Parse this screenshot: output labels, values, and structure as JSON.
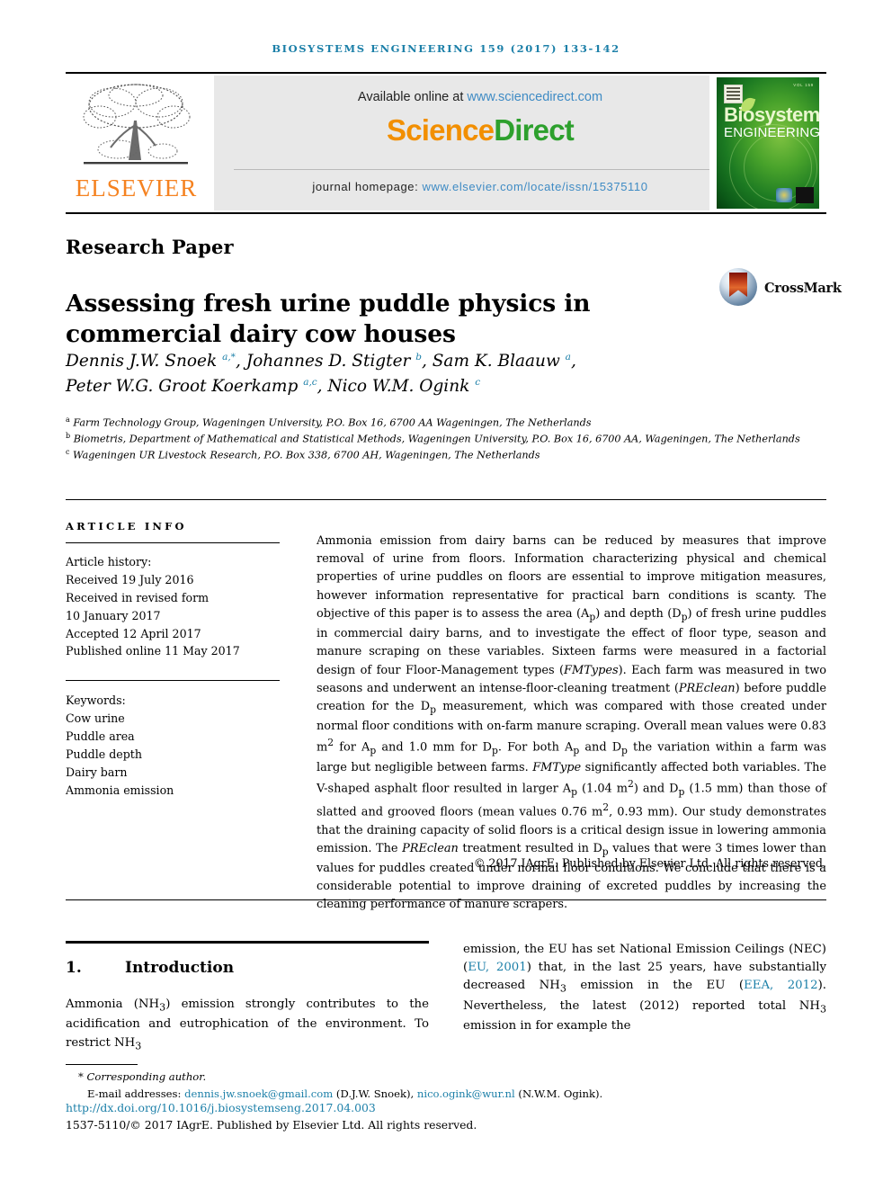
{
  "running_head": "BIOSYSTEMS ENGINEERING 159 (2017) 133-142",
  "masthead": {
    "available_label": "Available online at ",
    "available_url": "www.sciencedirect.com",
    "logo_first": "Science",
    "logo_second": "Direct",
    "homepage_label": "journal homepage: ",
    "homepage_url": "www.elsevier.com/locate/issn/15375110",
    "publisher_name": "ELSEVIER",
    "cover": {
      "title_line1": "Biosystems",
      "title_line2": "ENGINEERING",
      "volume_label": "VOL 159"
    }
  },
  "article": {
    "type": "Research Paper",
    "title": "Assessing fresh urine puddle physics in commercial dairy cow houses",
    "crossmark_label": "CrossMark",
    "authors_line1_a": "Dennis J.W. Snoek ",
    "authors_sup1": "a,*",
    "authors_line1_b": ", Johannes D. Stigter ",
    "authors_sup2": "b",
    "authors_line1_c": ", Sam K. Blaauw ",
    "authors_sup3": "a",
    "authors_line1_d": ",",
    "authors_line2_a": "Peter W.G. Groot Koerkamp ",
    "authors_sup4": "a,c",
    "authors_line2_b": ", Nico W.M. Ogink ",
    "authors_sup5": "c",
    "affiliations": [
      {
        "mark": "a",
        "text": "Farm Technology Group, Wageningen University, P.O. Box 16, 6700 AA Wageningen, The Netherlands"
      },
      {
        "mark": "b",
        "text": "Biometris, Department of Mathematical and Statistical Methods, Wageningen University, P.O. Box 16, 6700 AA, Wageningen, The Netherlands"
      },
      {
        "mark": "c",
        "text": "Wageningen UR Livestock Research, P.O. Box 338, 6700 AH, Wageningen, The Netherlands"
      }
    ]
  },
  "article_info": {
    "heading": "ARTICLE INFO",
    "history_label": "Article history:",
    "received": "Received 19 July 2016",
    "revised_label": "Received in revised form",
    "revised_date": "10 January 2017",
    "accepted": "Accepted 12 April 2017",
    "published": "Published online 11 May 2017",
    "keywords_label": "Keywords:",
    "keywords": [
      "Cow urine",
      "Puddle area",
      "Puddle depth",
      "Dairy barn",
      "Ammonia emission"
    ]
  },
  "abstract": {
    "p1": "Ammonia emission from dairy barns can be reduced by measures that improve removal of urine from floors. Information characterizing physical and chemical properties of urine puddles on floors are essential to improve mitigation measures, however information representative for practical barn conditions is scanty. The objective of this paper is to assess the area (A",
    "sub_p": "p",
    "p2": ") and depth (D",
    "p3": ") of fresh urine puddles in commercial dairy barns, and to investigate the effect of floor type, season and manure scraping on these variables. Sixteen farms were measured in a factorial design of four Floor-Management types (",
    "it_fmtypes": "FMTypes",
    "p4": "). Each farm was measured in two seasons and underwent an intense-floor-cleaning treatment (",
    "it_preclean": "PREclean",
    "p5": ") before puddle creation for the D",
    "p6": " measurement, which was compared with those created under normal floor conditions with on-farm manure scraping. Overall mean values were 0.83 m",
    "sup_2": "2",
    "p7": " for A",
    "p8": " and 1.0 mm for D",
    "p9": ". For both A",
    "p10": " and D",
    "p11": " the variation within a farm was large but negligible between farms. ",
    "it_fmtype": "FMType",
    "p12": " significantly affected both variables. The V-shaped asphalt floor resulted in larger A",
    "p13": " (1.04 m",
    "p14": ") and D",
    "p15": " (1.5 mm) than those of slatted and grooved floors (mean values 0.76 m",
    "p16": ", 0.93 mm). Our study demonstrates that the draining capacity of solid floors is a critical design issue in lowering ammonia emission. The ",
    "it_preclean2": "PREclean",
    "p17": " treatment resulted in D",
    "p18": " values that were 3 times lower than values for puddles created under normal floor conditions. We conclude that there is a considerable potential to improve draining of excreted puddles by increasing the cleaning performance of manure scrapers.",
    "copyright": "© 2017 IAgrE. Published by Elsevier Ltd. All rights reserved."
  },
  "body": {
    "section_number": "1.",
    "section_title": "Introduction",
    "left_p1": "Ammonia (NH",
    "left_sub3": "3",
    "left_p2": ") emission strongly contributes to the acidification and eutrophication of the environment. To restrict NH",
    "left_p3": "",
    "right_p1": "emission, the EU has set National Emission Ceilings (NEC) (",
    "right_link1": "EU, 2001",
    "right_p2": ") that, in the last 25 years, have substantially decreased NH",
    "right_p3": " emission in the EU (",
    "right_link2": "EEA, 2012",
    "right_p4": "). Nevertheless, the latest (2012) reported total NH",
    "right_p5": " emission in for example the"
  },
  "footer": {
    "corresponding": "* Corresponding author.",
    "emails_label": "E-mail addresses: ",
    "email1": "dennis.jw.snoek@gmail.com",
    "email1_owner": " (D.J.W. Snoek), ",
    "email2": "nico.ogink@wur.nl",
    "email2_owner": " (N.W.M. Ogink).",
    "doi": "http://dx.doi.org/10.1016/j.biosystemseng.2017.04.003",
    "issn": "1537-5110/© 2017 IAgrE. Published by Elsevier Ltd. All rights reserved."
  }
}
